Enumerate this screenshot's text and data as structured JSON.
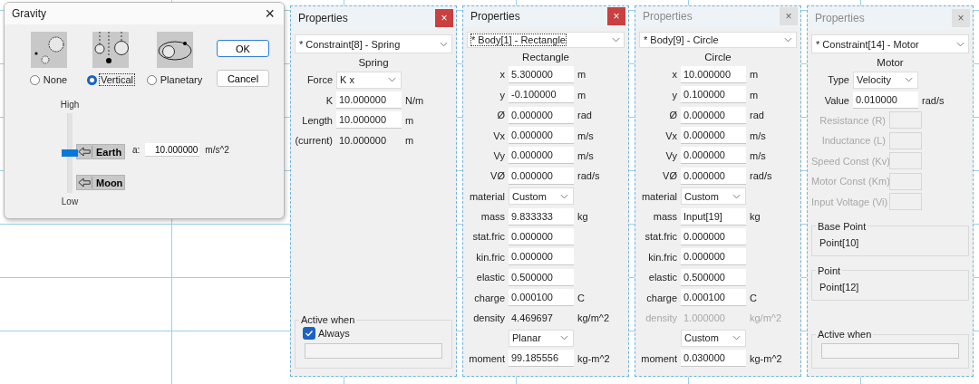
{
  "gravity": {
    "title": "Gravity",
    "close": "×",
    "options": [
      {
        "kind": "none",
        "label": "None",
        "selected": false
      },
      {
        "kind": "vertical",
        "label": "Vertical",
        "selected": true
      },
      {
        "kind": "planetary",
        "label": "Planetary",
        "selected": false
      }
    ],
    "buttons": [
      {
        "label": "OK",
        "default": true
      },
      {
        "label": "Cancel",
        "default": false
      }
    ],
    "slider": {
      "high": "High",
      "low": "Low",
      "level": 0.5
    },
    "presets": [
      "Earth",
      "Moon"
    ],
    "accel": {
      "label": "a:",
      "value": "10.000000",
      "unit": "m/s^2"
    }
  },
  "panels": [
    {
      "title": "Properties",
      "active": true,
      "close": "×",
      "selector": {
        "value": "* Constraint[8] - Spring",
        "focused": false
      },
      "heading": "Spring",
      "rows": [
        {
          "kind": "select",
          "label": "Force",
          "value": "K x",
          "disabled": false
        },
        {
          "kind": "field",
          "label": "K",
          "value": "10.000000",
          "unit": "N/m",
          "disabled": false
        },
        {
          "kind": "field",
          "label": "Length",
          "value": "10.000000",
          "unit": "m",
          "disabled": false
        },
        {
          "kind": "readout",
          "label": "(current)",
          "value": "10.000000",
          "unit": "m",
          "disabled": false
        }
      ],
      "active_when": {
        "title": "Active when",
        "checkbox": {
          "label": "Always",
          "checked": true
        }
      }
    },
    {
      "title": "Properties",
      "active": true,
      "close": "×",
      "selector": {
        "value": "* Body[1] - Rectangle",
        "focused": true
      },
      "heading": "Rectangle",
      "rows": [
        {
          "kind": "field",
          "label": "x",
          "value": "5.300000",
          "unit": "m",
          "disabled": false
        },
        {
          "kind": "field",
          "label": "y",
          "value": "-0.100000",
          "unit": "m",
          "disabled": false
        },
        {
          "kind": "field",
          "label": "Ø",
          "value": "0.000000",
          "unit": "rad",
          "disabled": false
        },
        {
          "kind": "field",
          "label": "Vx",
          "value": "0.000000",
          "unit": "m/s",
          "disabled": false
        },
        {
          "kind": "field",
          "label": "Vy",
          "value": "0.000000",
          "unit": "m/s",
          "disabled": false
        },
        {
          "kind": "field",
          "label": "VØ",
          "value": "0.000000",
          "unit": "rad/s",
          "disabled": false
        },
        {
          "kind": "select",
          "label": "material",
          "value": "Custom",
          "disabled": false
        },
        {
          "kind": "field",
          "label": "mass",
          "value": "9.833333",
          "unit": "kg",
          "disabled": false
        },
        {
          "kind": "field",
          "label": "stat.fric",
          "value": "0.000000",
          "disabled": false
        },
        {
          "kind": "field",
          "label": "kin.fric",
          "value": "0.000000",
          "disabled": false
        },
        {
          "kind": "field",
          "label": "elastic",
          "value": "0.500000",
          "disabled": false
        },
        {
          "kind": "field",
          "label": "charge",
          "value": "0.000100",
          "unit": "C",
          "disabled": false
        },
        {
          "kind": "readout",
          "label": "density",
          "value": "4.469697",
          "unit": "kg/m^2",
          "disabled": false
        },
        {
          "kind": "select",
          "value": "Planar",
          "disabled": false
        },
        {
          "kind": "field",
          "label": "moment",
          "value": "99.185556",
          "unit": "kg-m^2",
          "disabled": false
        }
      ]
    },
    {
      "title": "Properties",
      "active": false,
      "close": "×",
      "selector": {
        "value": "* Body[9] - Circle",
        "focused": false
      },
      "heading": "Circle",
      "rows": [
        {
          "kind": "field",
          "label": "x",
          "value": "10.000000",
          "unit": "m",
          "disabled": false
        },
        {
          "kind": "field",
          "label": "y",
          "value": "0.100000",
          "unit": "m",
          "disabled": false
        },
        {
          "kind": "field",
          "label": "Ø",
          "value": "0.000000",
          "unit": "rad",
          "disabled": false
        },
        {
          "kind": "field",
          "label": "Vx",
          "value": "0.000000",
          "unit": "m/s",
          "disabled": false
        },
        {
          "kind": "field",
          "label": "Vy",
          "value": "0.000000",
          "unit": "m/s",
          "disabled": false
        },
        {
          "kind": "field",
          "label": "VØ",
          "value": "0.000000",
          "unit": "rad/s",
          "disabled": false
        },
        {
          "kind": "select",
          "label": "material",
          "value": "Custom",
          "disabled": false
        },
        {
          "kind": "field",
          "label": "mass",
          "value": "Input[19]",
          "unit": "kg",
          "disabled": false
        },
        {
          "kind": "field",
          "label": "stat.fric",
          "value": "0.000000",
          "disabled": false
        },
        {
          "kind": "field",
          "label": "kin.fric",
          "value": "0.000000",
          "disabled": false
        },
        {
          "kind": "field",
          "label": "elastic",
          "value": "0.500000",
          "disabled": false
        },
        {
          "kind": "field",
          "label": "charge",
          "value": "0.000100",
          "unit": "C",
          "disabled": false
        },
        {
          "kind": "readout",
          "label": "density",
          "value": "1.000000",
          "unit": "kg/m^2",
          "disabled": true
        },
        {
          "kind": "select",
          "value": "Custom",
          "disabled": false
        },
        {
          "kind": "field",
          "label": "moment",
          "value": "0.030000",
          "unit": "kg-m^2",
          "disabled": false
        }
      ]
    },
    {
      "title": "Properties",
      "active": false,
      "close": "×",
      "selector": {
        "value": "* Constraint[14] - Motor",
        "focused": false
      },
      "heading": "Motor",
      "rows": [
        {
          "kind": "select",
          "label": "Type",
          "value": "Velocity",
          "disabled": false
        },
        {
          "kind": "field",
          "label": "Value",
          "value": "0.010000",
          "unit": "rad/s",
          "disabled": false
        },
        {
          "kind": "field",
          "label": "Resistance (R)",
          "disabled": true
        },
        {
          "kind": "field",
          "label": "Inductance (L)",
          "disabled": true
        },
        {
          "kind": "field",
          "label": "Speed Const (Kv)",
          "disabled": true
        },
        {
          "kind": "field",
          "label": "Motor Const (Km)",
          "disabled": true
        },
        {
          "kind": "field",
          "label": "Input Voltage (Vi)",
          "disabled": true
        }
      ],
      "groups": [
        {
          "title": "Base Point",
          "value": "Point[10]"
        },
        {
          "title": "Point",
          "value": "Point[12]"
        }
      ],
      "active_when": {
        "title": "Active when"
      }
    }
  ]
}
